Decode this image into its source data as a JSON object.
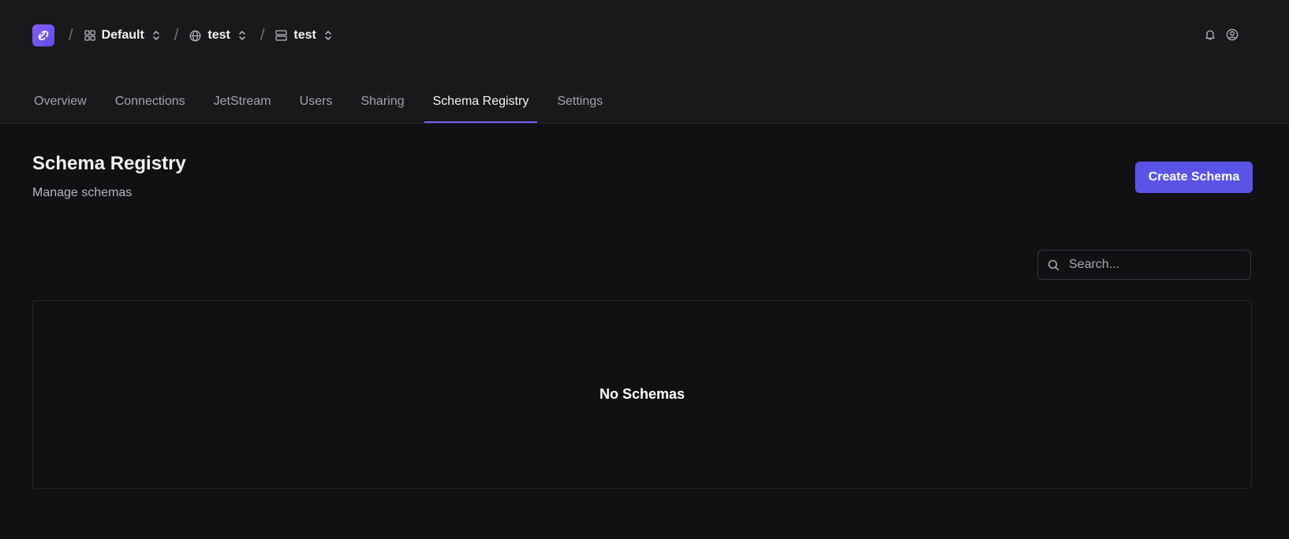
{
  "breadcrumb": {
    "items": [
      {
        "icon": "grid-icon",
        "label": "Default"
      },
      {
        "icon": "globe-icon",
        "label": "test"
      },
      {
        "icon": "server-icon",
        "label": "test"
      }
    ],
    "separator": "/"
  },
  "header_icons": [
    "bell-icon",
    "user-circle-icon"
  ],
  "tabs": [
    {
      "label": "Overview"
    },
    {
      "label": "Connections"
    },
    {
      "label": "JetStream"
    },
    {
      "label": "Users"
    },
    {
      "label": "Sharing"
    },
    {
      "label": "Schema Registry",
      "active": true
    },
    {
      "label": "Settings"
    }
  ],
  "page": {
    "title": "Schema Registry",
    "subtitle": "Manage schemas",
    "create_label": "Create Schema"
  },
  "search": {
    "placeholder": "Search..."
  },
  "empty_state": {
    "text": "No Schemas"
  },
  "colors": {
    "accent": "#5b53e6",
    "background": "#111114",
    "header": "#19191c"
  }
}
